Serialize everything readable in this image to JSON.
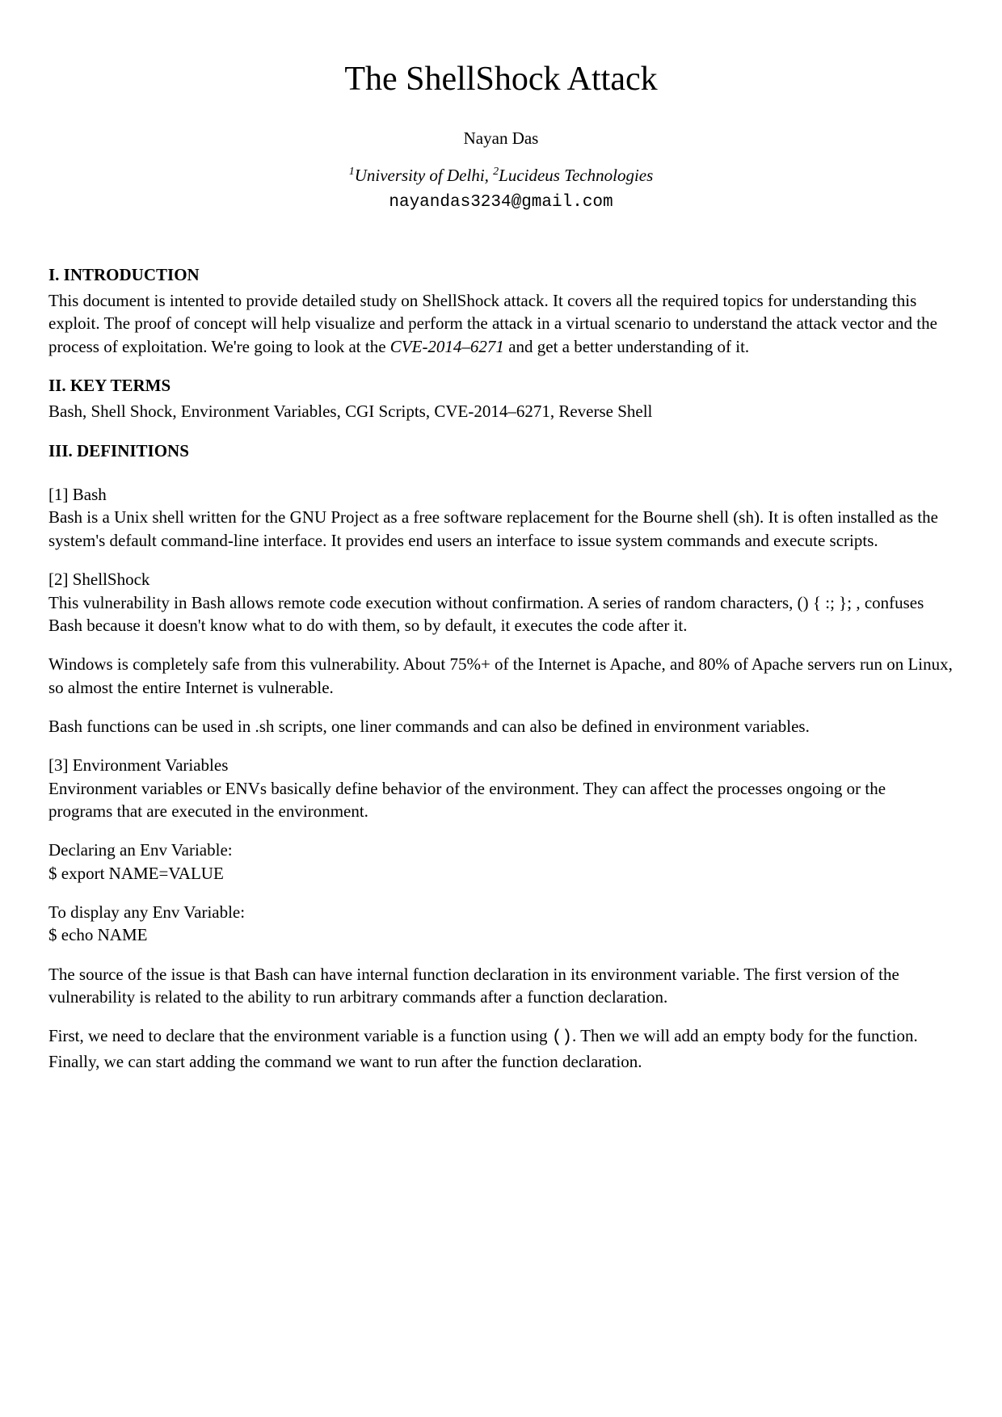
{
  "title": "The ShellShock Attack",
  "author": "Nayan Das",
  "affiliation1_sup": "1",
  "affiliation1": "University of Delhi, ",
  "affiliation2_sup": "2",
  "affiliation2": "Lucideus Technologies",
  "email": "nayandas3234@gmail.com",
  "sec1_heading": "I. INTRODUCTION",
  "sec1_p1_a": "This document is intented to provide detailed study on ShellShock attack. It covers all the required topics for understanding this exploit. The proof of concept will help visualize and perform the attack in a virtual scenario to understand the attack vector and the process of exploitation. We're going to look at the ",
  "sec1_p1_cve": "CVE-2014–6271",
  "sec1_p1_b": " and get a better understanding of it.",
  "sec2_heading": "II. KEY TERMS",
  "sec2_p1": "Bash, Shell Shock, Environment Variables, CGI Scripts,  CVE-2014–6271, Reverse Shell",
  "sec3_heading": "III. DEFINITIONS",
  "def1_heading": "[1] Bash",
  "def1_p1": "Bash is a Unix shell written for the GNU Project as a free software replacement for the Bourne shell (sh). It is often installed as the system's default command-line interface. It provides end users an interface to issue system commands and execute scripts.",
  "def2_heading": "[2] ShellShock",
  "def2_p1": "This vulnerability in Bash allows remote code execution without confirmation. A series of random characters, () { :; }; , confuses Bash because it doesn't know what to do with them, so by default, it executes the code after it.",
  "def2_p2": "Windows is completely safe from this vulnerability. About 75%+ of the Internet is Apache, and 80% of Apache servers run on Linux, so almost the entire Internet is vulnerable.",
  "def2_p3": "Bash functions can be used in .sh scripts, one liner commands and can also be  defined in environment variables.",
  "def3_heading": "[3] Environment Variables",
  "def3_p1": "Environment variables or ENVs basically define behavior of the environment. They can affect the processes ongoing or the programs that are executed in the environment.",
  "def3_declare_label": "Declaring an Env Variable:",
  "def3_declare_cmd": "$ export NAME=VALUE",
  "def3_display_label": "To display any Env Variable:",
  "def3_display_cmd": "$ echo NAME",
  "def3_p2": "The source of the issue is that Bash can have internal function declaration in its environment variable. The first version of the vulnerability is related to the ability to run arbitrary commands after a function declaration.",
  "def3_p3_a": "First, we need to declare that the environment variable is a function using ",
  "def3_p3_mono": "()",
  "def3_p3_b": ". Then we will add an empty body for the function. Finally, we can start adding the command we want to run after the function declaration."
}
